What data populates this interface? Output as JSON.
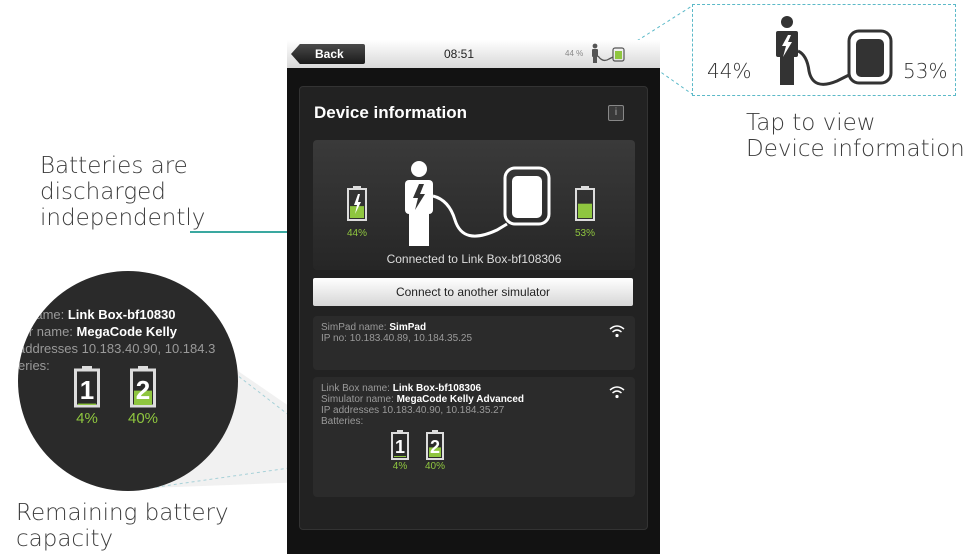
{
  "annotations": {
    "batteries_line1": "Batteries are",
    "batteries_line2": "discharged",
    "batteries_line3": "independently",
    "tap_line1": "Tap to view",
    "tap_line2": "Device information",
    "remaining_line1": "Remaining battery",
    "remaining_line2": "capacity"
  },
  "statusbar": {
    "back_label": "Back",
    "time": "08:51",
    "battery_pct": "44 %"
  },
  "device_info": {
    "title": "Device information",
    "info_icon": "i",
    "left_battery_pct": "44%",
    "right_battery_pct": "53%",
    "connected_text": "Connected to Link Box-bf108306",
    "connect_button": "Connect to another simulator",
    "simpad": {
      "name_label": "SimPad name: ",
      "name_value": "SimPad",
      "ip_text": "IP no: 10.183.40.89, 10.184.35.25"
    },
    "linkbox": {
      "name_label": "Link Box name: ",
      "name_value": "Link Box-bf108306",
      "sim_label": "Simulator name: ",
      "sim_value": "MegaCode Kelly Advanced",
      "ip_text": "IP addresses 10.183.40.90, 10.184.35.27",
      "batteries_label": "Batteries:",
      "battery1_num": "1",
      "battery1_pct": "4%",
      "battery1_level": 0.04,
      "battery2_num": "2",
      "battery2_pct": "40%",
      "battery2_level": 0.4
    }
  },
  "zoom_circle": {
    "row1_label": "k name: ",
    "row1_value": "Link Box-bf10830",
    "row2_label": "tor name: ",
    "row2_value": "MegaCode Kelly",
    "row3": "addresses 10.183.40.90, 10.184.3",
    "row4": "eries:",
    "battery1_num": "1",
    "battery1_pct": "4%",
    "battery2_num": "2",
    "battery2_pct": "40%"
  },
  "zoom_box": {
    "left_pct": "44%",
    "right_pct": "53%"
  },
  "colors": {
    "accent_green": "#8fc63f",
    "pointer_teal": "#3aa8a0",
    "dash_blue": "#5bb9c8"
  },
  "levels": {
    "left_battery": 0.44,
    "right_battery": 0.53
  }
}
